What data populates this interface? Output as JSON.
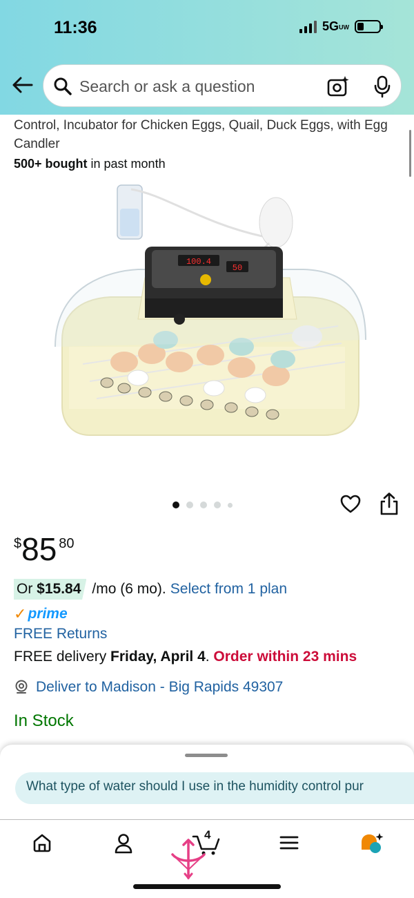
{
  "status_bar": {
    "time": "11:36",
    "network": "5G",
    "network_badge": "UW"
  },
  "search": {
    "placeholder": "Search or ask a question"
  },
  "product": {
    "title_partial": "Control, Incubator for Chicken Eggs, Quail, Duck Eggs, with Egg Candler",
    "bought_count": "500+ bought",
    "bought_suffix": " in past month",
    "display_readout_left": "100.4",
    "display_readout_right": "50"
  },
  "gallery": {
    "image_count": 5,
    "active_index": 0
  },
  "price": {
    "symbol": "$",
    "whole": "85",
    "fraction": "80"
  },
  "monthly": {
    "prefix": "Or",
    "amount": "$15.84",
    "suffix": " /mo (6 mo).",
    "link": "Select from 1 plan"
  },
  "prime": {
    "check": "✓",
    "label": "prime"
  },
  "returns": {
    "label": "FREE Returns"
  },
  "delivery": {
    "prefix": "FREE delivery ",
    "date": "Friday, April 4",
    "separator": ". ",
    "urgency": "Order within 23 mins"
  },
  "location": {
    "label": "Deliver to Madison - Big Rapids 49307"
  },
  "availability": {
    "label": "In Stock"
  },
  "assistant": {
    "suggestion": "What type of water should I use in the humidity control pur"
  },
  "nav": {
    "cart_count": "4"
  },
  "colors": {
    "header_gradient_start": "#82d8e3",
    "header_gradient_end": "#a5e4d8",
    "link": "#2162a1",
    "urgent": "#cc0c39",
    "in_stock": "#007600",
    "prime_blue": "#1399ff",
    "prime_orange": "#f08804",
    "assistant_bubble": "#def2f4"
  }
}
